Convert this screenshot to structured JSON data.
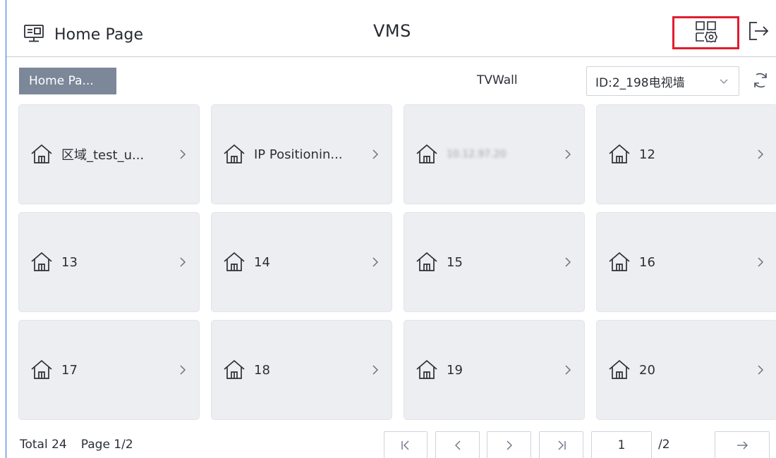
{
  "header": {
    "page_title": "Home Page",
    "app_title": "VMS",
    "page_icon": "monitor-icon",
    "settings_icon": "layout-settings-icon",
    "logout_icon": "logout-icon",
    "highlight_color": "#e11d2e"
  },
  "toolbar": {
    "breadcrumb": "Home Pa...",
    "tvwall_label": "TVWall",
    "tvwall_selected": "ID:2_198电视墙",
    "refresh_icon": "refresh-icon"
  },
  "tiles": [
    {
      "label": "区域_test_u...",
      "blurred": false
    },
    {
      "label": "IP Positionin...",
      "blurred": false
    },
    {
      "label": "10.12.97.20",
      "blurred": true
    },
    {
      "label": "12",
      "blurred": false
    },
    {
      "label": "13",
      "blurred": false
    },
    {
      "label": "14",
      "blurred": false
    },
    {
      "label": "15",
      "blurred": false
    },
    {
      "label": "16",
      "blurred": false
    },
    {
      "label": "17",
      "blurred": false
    },
    {
      "label": "18",
      "blurred": false
    },
    {
      "label": "19",
      "blurred": false
    },
    {
      "label": "20",
      "blurred": false
    }
  ],
  "pagination": {
    "total": "Total 24",
    "page": "Page 1/2",
    "current_page": "1",
    "total_pages": "/2"
  },
  "colors": {
    "breadcrumb_bg": "#7c8799",
    "tile_bg": "#edeef2",
    "accent_rule": "#2f6fd6"
  }
}
